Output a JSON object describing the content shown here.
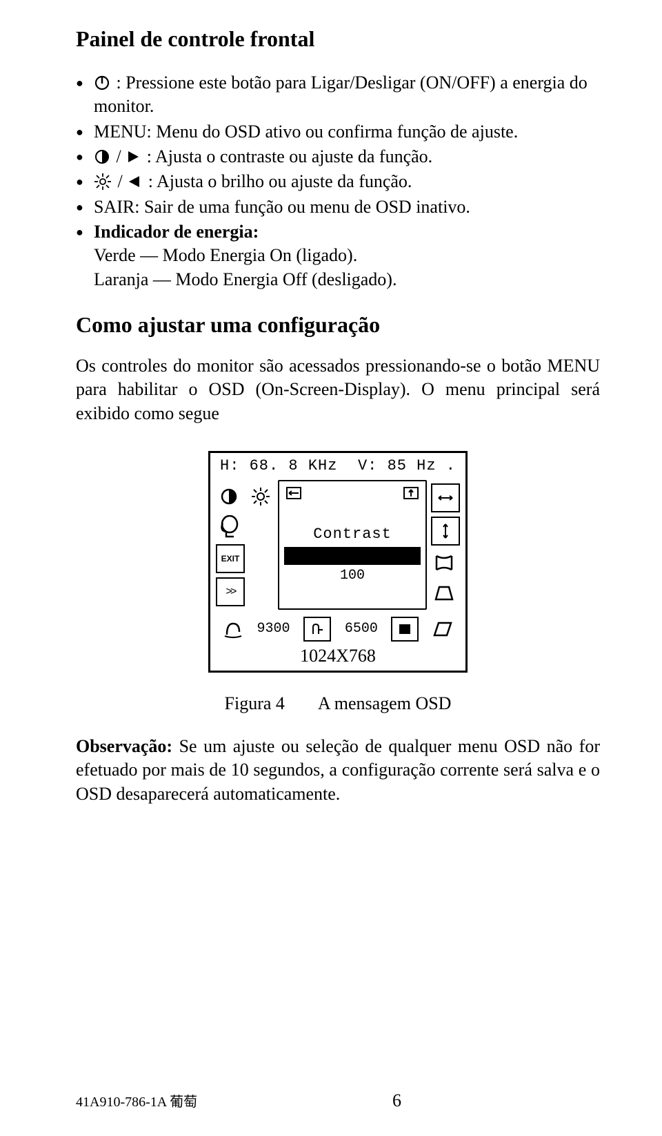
{
  "heading1": "Painel de controle frontal",
  "bullets": [
    {
      "icon": "power-icon",
      "text_after": " : Pressione este botão para Ligar/Desligar (ON/OFF) a energia do monitor."
    },
    {
      "text": "MENU: Menu do OSD ativo ou confirma função de ajuste."
    },
    {
      "icons": [
        "contrast-icon",
        "play-right-icon"
      ],
      "text_after": " : Ajusta o contraste ou ajuste da função."
    },
    {
      "icons": [
        "brightness-icon",
        "play-left-icon"
      ],
      "text_after": " : Ajusta o brilho ou ajuste da função."
    },
    {
      "text": "SAIR: Sair de uma função ou menu de OSD inativo."
    },
    {
      "bold": "Indicador de energia:",
      "lines": [
        "Verde   — Modo Energia On (ligado).",
        "Laranja — Modo Energia Off (desligado)."
      ]
    }
  ],
  "heading2": "Como ajustar uma configuração",
  "para1": "Os controles do monitor são acessados pressionando-se o botão MENU para habilitar o OSD (On-Screen-Display). O menu principal será exibido como segue",
  "osd": {
    "h_label": "H: 68. 8 KHz",
    "v_label": "V:  85 Hz .",
    "center_label": "Contrast",
    "center_value": "100",
    "bottom_val1": "9300",
    "bottom_val2": "6500",
    "resolution": "1024X768"
  },
  "caption": {
    "left": "Figura 4",
    "right": "A mensagem OSD"
  },
  "observation_label": "Observação:",
  "observation_text": " Se um ajuste ou seleção de qualquer menu OSD não for efetuado por mais de 10 segundos, a configuração corrente será salva e o OSD desaparecerá automaticamente.",
  "footer_left": "41A910-786-1A 葡萄",
  "footer_page": "6"
}
